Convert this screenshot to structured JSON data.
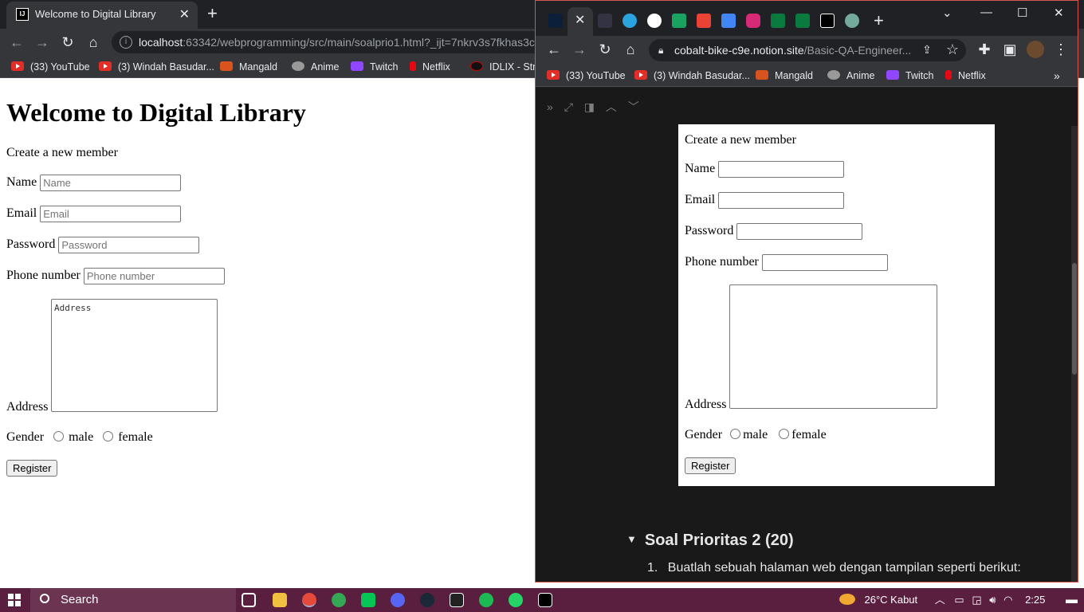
{
  "left_browser": {
    "tab_title": "Welcome to Digital Library",
    "tab_favicon": "IJ",
    "url_host": "localhost",
    "url_rest": ":63342/webprogramming/src/main/soalprio1.html?_ijt=7nkrv3s7fkhas3c",
    "bookmarks": [
      "(33) YouTube",
      "(3) Windah Basudar...",
      "Mangald",
      "Anime",
      "Twitch",
      "Netflix",
      "IDLIX - Stre"
    ]
  },
  "left_page": {
    "heading": "Welcome to Digital Library",
    "subheading": "Create a new member",
    "name_label": "Name",
    "name_placeholder": "Name",
    "email_label": "Email",
    "email_placeholder": "Email",
    "password_label": "Password",
    "password_placeholder": "Password",
    "phone_label": "Phone number",
    "phone_placeholder": "Phone number",
    "address_label": "Address",
    "address_placeholder": "Address",
    "gender_label": "Gender",
    "gender_male": "male",
    "gender_female": "female",
    "register_button": "Register"
  },
  "right_browser": {
    "url_host": "cobalt-bike-c9e.notion.site",
    "url_rest": "/Basic-QA-Engineer...",
    "bookmarks": [
      "(33) YouTube",
      "(3) Windah Basudar...",
      "Mangald",
      "Anime",
      "Twitch",
      "Netflix"
    ],
    "bookmarks_overflow": "»"
  },
  "right_page": {
    "subheading": "Create a new member",
    "name_label": "Name",
    "email_label": "Email",
    "password_label": "Password",
    "phone_label": "Phone number",
    "address_label": "Address",
    "gender_label": "Gender",
    "gender_male": "male",
    "gender_female": "female",
    "register_button": "Register",
    "section_title": "Soal Prioritas 2 (20)",
    "list_number": "1.",
    "list_text": "Buatlah sebuah halaman web dengan tampilan seperti berikut:"
  },
  "taskbar": {
    "search_label": "Search",
    "weather": "26°C  Kabut",
    "time": "2:25"
  },
  "colors": {
    "taskbar_bg": "#5a1f3e",
    "chrome_dark": "#202124",
    "chrome_toolbar": "#35363a",
    "notion_bg": "#191919",
    "window_border": "#d9534f"
  }
}
